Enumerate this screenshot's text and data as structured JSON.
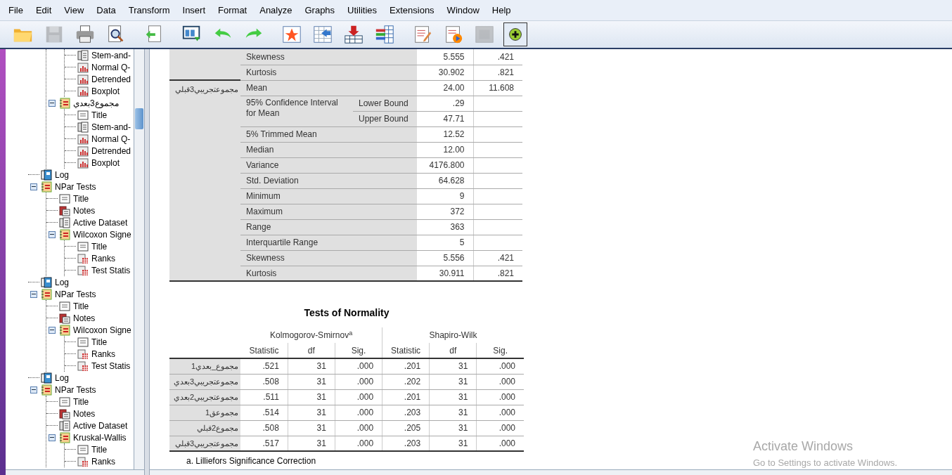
{
  "menu": [
    "File",
    "Edit",
    "View",
    "Data",
    "Transform",
    "Insert",
    "Format",
    "Analyze",
    "Graphs",
    "Utilities",
    "Extensions",
    "Window",
    "Help"
  ],
  "toolbar": [
    {
      "disabled": false,
      "selected": false
    },
    {
      "disabled": true,
      "selected": false
    },
    {
      "disabled": false,
      "selected": false
    },
    {
      "disabled": false,
      "selected": false
    },
    {
      "disabled": false,
      "selected": false
    },
    {
      "disabled": false,
      "selected": false
    },
    {
      "disabled": false,
      "selected": false
    },
    {
      "disabled": false,
      "selected": false
    },
    {
      "disabled": false,
      "selected": false
    },
    {
      "disabled": false,
      "selected": false
    },
    {
      "disabled": false,
      "selected": false
    },
    {
      "disabled": false,
      "selected": false
    },
    {
      "disabled": false,
      "selected": false
    },
    {
      "disabled": false,
      "selected": false
    },
    {
      "disabled": true,
      "selected": false
    },
    {
      "disabled": false,
      "selected": true
    }
  ],
  "tree": [
    {
      "kind": "hidden",
      "children": [
        {
          "kind": "hidden",
          "children": [
            {
              "label": "Stem-and-",
              "kind": "text"
            },
            {
              "label": "Normal Q-",
              "kind": "chart"
            },
            {
              "label": "Detrended",
              "kind": "chart"
            },
            {
              "label": "Boxplot",
              "kind": "chart"
            }
          ]
        },
        {
          "label": "مجموع3بعدي",
          "kind": "group",
          "expanded": true,
          "children": [
            {
              "label": "Title",
              "kind": "title"
            },
            {
              "label": "Stem-and-",
              "kind": "text"
            },
            {
              "label": "Normal Q-",
              "kind": "chart"
            },
            {
              "label": "Detrended",
              "kind": "chart"
            },
            {
              "label": "Boxplot",
              "kind": "chart"
            }
          ]
        }
      ]
    },
    {
      "label": "Log",
      "kind": "log"
    },
    {
      "label": "NPar Tests",
      "kind": "group",
      "expanded": true,
      "children": [
        {
          "label": "Title",
          "kind": "title"
        },
        {
          "label": "Notes",
          "kind": "notes"
        },
        {
          "label": "Active Dataset",
          "kind": "text"
        },
        {
          "label": "Wilcoxon Signe",
          "kind": "group",
          "expanded": true,
          "children": [
            {
              "label": "Title",
              "kind": "title"
            },
            {
              "label": "Ranks",
              "kind": "table"
            },
            {
              "label": "Test Statis",
              "kind": "table"
            }
          ]
        }
      ]
    },
    {
      "label": "Log",
      "kind": "log"
    },
    {
      "label": "NPar Tests",
      "kind": "group",
      "expanded": true,
      "children": [
        {
          "label": "Title",
          "kind": "title"
        },
        {
          "label": "Notes",
          "kind": "notes"
        },
        {
          "label": "Wilcoxon Signe",
          "kind": "group",
          "expanded": true,
          "children": [
            {
              "label": "Title",
              "kind": "title"
            },
            {
              "label": "Ranks",
              "kind": "table"
            },
            {
              "label": "Test Statis",
              "kind": "table"
            }
          ]
        }
      ]
    },
    {
      "label": "Log",
      "kind": "log"
    },
    {
      "label": "NPar Tests",
      "kind": "group",
      "expanded": true,
      "children": [
        {
          "label": "Title",
          "kind": "title"
        },
        {
          "label": "Notes",
          "kind": "notes"
        },
        {
          "label": "Active Dataset",
          "kind": "text"
        },
        {
          "label": "Kruskal-Wallis",
          "kind": "group",
          "expanded": true,
          "children": [
            {
              "label": "Title",
              "kind": "title"
            },
            {
              "label": "Ranks",
              "kind": "table"
            }
          ]
        }
      ]
    }
  ],
  "descriptives": {
    "groups": [
      {
        "rows": [
          {
            "label": "Skewness",
            "value": "5.555",
            "std_error": ".421"
          },
          {
            "label": "Kurtosis",
            "value": "30.902",
            "std_error": ".821"
          }
        ]
      },
      {
        "variable": "مجموعتجريبي3قبلي",
        "rows": [
          {
            "label": "Mean",
            "value": "24.00",
            "std_error": "11.608"
          },
          {
            "label": "95% Confidence Interval for Mean",
            "bounds": [
              {
                "label": "Lower Bound",
                "value": ".29"
              },
              {
                "label": "Upper Bound",
                "value": "47.71"
              }
            ]
          },
          {
            "label": "5% Trimmed Mean",
            "value": "12.52"
          },
          {
            "label": "Median",
            "value": "12.00"
          },
          {
            "label": "Variance",
            "value": "4176.800"
          },
          {
            "label": "Std. Deviation",
            "value": "64.628"
          },
          {
            "label": "Minimum",
            "value": "9"
          },
          {
            "label": "Maximum",
            "value": "372"
          },
          {
            "label": "Range",
            "value": "363"
          },
          {
            "label": "Interquartile Range",
            "value": "5"
          },
          {
            "label": "Skewness",
            "value": "5.556",
            "std_error": ".421"
          },
          {
            "label": "Kurtosis",
            "value": "30.911",
            "std_error": ".821"
          }
        ]
      }
    ]
  },
  "normality": {
    "title": "Tests of Normality",
    "column_groups": [
      "Kolmogorov-Smirnov$^{a}$",
      "Shapiro-Wilk"
    ],
    "columns": [
      "Statistic",
      "df",
      "Sig.",
      "Statistic",
      "df",
      "Sig."
    ],
    "rows": [
      {
        "label": "مجموع_بعدي1",
        "values": [
          ".521",
          "31",
          ".000",
          ".201",
          "31",
          ".000"
        ]
      },
      {
        "label": "مجموعتجريبي3بعدي",
        "values": [
          ".508",
          "31",
          ".000",
          ".202",
          "31",
          ".000"
        ]
      },
      {
        "label": "مجموعتجريبي2بعدي",
        "values": [
          ".511",
          "31",
          ".000",
          ".201",
          "31",
          ".000"
        ]
      },
      {
        "label": "مجموعق1",
        "values": [
          ".514",
          "31",
          ".000",
          ".203",
          "31",
          ".000"
        ]
      },
      {
        "label": "مجموع2قبلي",
        "values": [
          ".508",
          "31",
          ".000",
          ".205",
          "31",
          ".000"
        ]
      },
      {
        "label": "مجموعتجريبي3قبلي",
        "values": [
          ".517",
          "31",
          ".000",
          ".203",
          "31",
          ".000"
        ]
      }
    ],
    "footnote": "a. Lilliefors Significance Correction"
  },
  "activation": {
    "title": "Activate Windows",
    "message": "Go to Settings to activate Windows."
  }
}
